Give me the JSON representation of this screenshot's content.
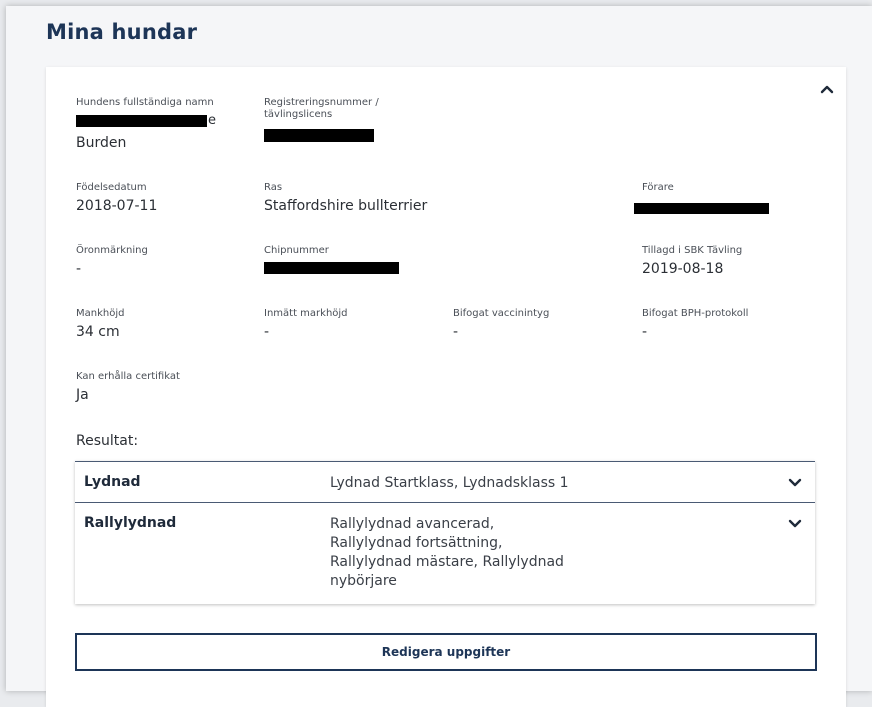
{
  "page": {
    "title": "Mina hundar"
  },
  "dog": {
    "fields": {
      "full_name": {
        "label": "Hundens fullständiga namn",
        "value_partial_end": "e",
        "value_line2": "Burden"
      },
      "reg_number": {
        "label_line1": "Registreringsnummer /",
        "label_line2": "tävlingslicens"
      },
      "birth_date": {
        "label": "Födelsedatum",
        "value": "2018-07-11"
      },
      "breed": {
        "label": "Ras",
        "value": "Staffordshire bullterrier"
      },
      "handler": {
        "label": "Förare"
      },
      "ear_mark": {
        "label": "Öronmärkning",
        "value": "-"
      },
      "chip_number": {
        "label": "Chipnummer"
      },
      "added": {
        "label": "Tillagd i SBK Tävling",
        "value": "2019-08-18"
      },
      "height": {
        "label": "Mankhöjd",
        "value": "34 cm"
      },
      "measured_height": {
        "label": "Inmätt markhöjd",
        "value": "-"
      },
      "vaccine": {
        "label": "Bifogat vaccinintyg",
        "value": "-"
      },
      "bph": {
        "label": "Bifogat BPH-protokoll",
        "value": "-"
      },
      "certificate": {
        "label": "Kan erhålla certifikat",
        "value": "Ja"
      }
    }
  },
  "results": {
    "label": "Resultat:",
    "rows": [
      {
        "discipline": "Lydnad",
        "classes": [
          "Lydnad Startklass, Lydnadsklass 1"
        ]
      },
      {
        "discipline": "Rallylydnad",
        "classes": [
          "Rallylydnad avancerad,",
          "Rallylydnad fortsättning,",
          "Rallylydnad mästare, Rallylydnad",
          "nybörjare"
        ]
      }
    ]
  },
  "actions": {
    "edit_label": "Redigera uppgifter"
  },
  "icons": {
    "collapse": "chevron-up-icon",
    "expand": "chevron-down-icon"
  },
  "colors": {
    "primary": "#1d3557",
    "redaction": "#000000"
  }
}
